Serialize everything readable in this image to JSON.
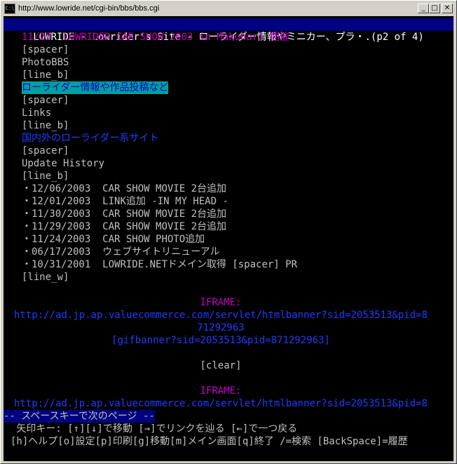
{
  "window": {
    "title": "http://www.lowride.net/cgi-bin/bbs/bbs.cgi",
    "app_icon_text": "C:\\",
    "min_symbol": "_",
    "max_symbol": "□",
    "close_symbol": "✕"
  },
  "terminal": {
    "status_title": "LOWRIDE - Lowrider's Site - ローライダー情報やミニカー、プラ・.(p2 of 4)",
    "lines": {
      "event": "11/23  LOWRIDER CAR SHOW 2003 in Makuhari 開催",
      "spacer1": "[spacer]",
      "photobbs": "PhotoBBS",
      "line_b1": "[line_b]",
      "photobbs_link": "ローライダー情報や作品投稿など",
      "spacer2": "[spacer]",
      "links": "Links",
      "line_b2": "[line_b]",
      "links_link": "国内外のローライダー系サイト",
      "spacer3": "[spacer]",
      "update_history": "Update History",
      "line_b3": "[line_b]",
      "line_w": "[line_w]"
    },
    "updates": [
      {
        "date": "・12/06/2003",
        "text": "CAR SHOW MOVIE 2台追加"
      },
      {
        "date": "・12/01/2003",
        "text": "LINK追加 -IN MY HEAD -"
      },
      {
        "date": "・11/30/2003",
        "text": "CAR SHOW MOVIE 2台追加"
      },
      {
        "date": "・11/29/2003",
        "text": "CAR SHOW MOVIE 2台追加"
      },
      {
        "date": "・11/24/2003",
        "text": "CAR SHOW PHOTO追加"
      },
      {
        "date": "・06/17/2003",
        "text": "ウェブサイトリニューアル"
      },
      {
        "date": "・10/31/2001",
        "text": "LOWRIDE.NETドメイン取得 [spacer] PR"
      }
    ],
    "iframe1": {
      "label": "IFRAME:",
      "url_line1": "http://ad.jp.ap.valuecommerce.com/servlet/htmlbanner?sid=2053513&pid=8",
      "url_line2": "71292963",
      "gifbanner": "[gifbanner?sid=2053513&pid=871292963]"
    },
    "clear": "[clear]",
    "iframe2": {
      "label": "IFRAME:",
      "url_line1": "http://ad.jp.ap.valuecommerce.com/servlet/htmlbanner?sid=2053513&pid=8"
    },
    "prompt": "-- スペースキーで次のページ --",
    "help1": " 矢印キー: [↑][↓]で移動 [→]でリンクを辿る [←]で一つ戻る",
    "help2": "[h]ヘルプ[o]設定[p]印刷[g]移動[m]メイン画面[q]終了 /=検索 [BackSpace]=履歴"
  },
  "colors": {
    "background": "#000000",
    "status_bar": "#000080",
    "text": "#c0c0c0",
    "link": "#1e3cff",
    "magenta": "#c000c0",
    "highlight": "#00a0a0"
  }
}
